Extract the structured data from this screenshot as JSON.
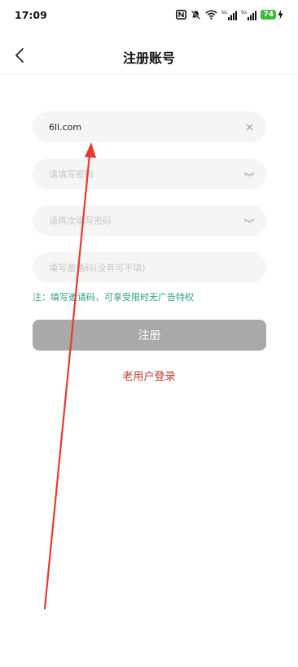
{
  "status_bar": {
    "time": "17:09",
    "battery_level": "74",
    "signal1_label": "5G",
    "signal2_label": "5G"
  },
  "header": {
    "title": "注册账号"
  },
  "form": {
    "username_value": "6ll.com",
    "password_placeholder": "请填写密码",
    "confirm_placeholder": "请再次填写密码",
    "invite_placeholder": "填写邀请码(没有可不填)",
    "note": "注：填写邀请码，可享受限时无广告特权",
    "register_label": "注册",
    "login_link": "老用户登录"
  },
  "colors": {
    "note_text": "#2e9e82",
    "button_disabled": "#a9a9a9",
    "login_link": "#c0392b",
    "annotation_arrow": "#e83a2f"
  },
  "icons": [
    "nfc-icon",
    "mute-icon",
    "wifi-icon",
    "signal-icon",
    "battery-icon",
    "back-chevron-icon",
    "clear-icon",
    "eye-closed-icon"
  ]
}
